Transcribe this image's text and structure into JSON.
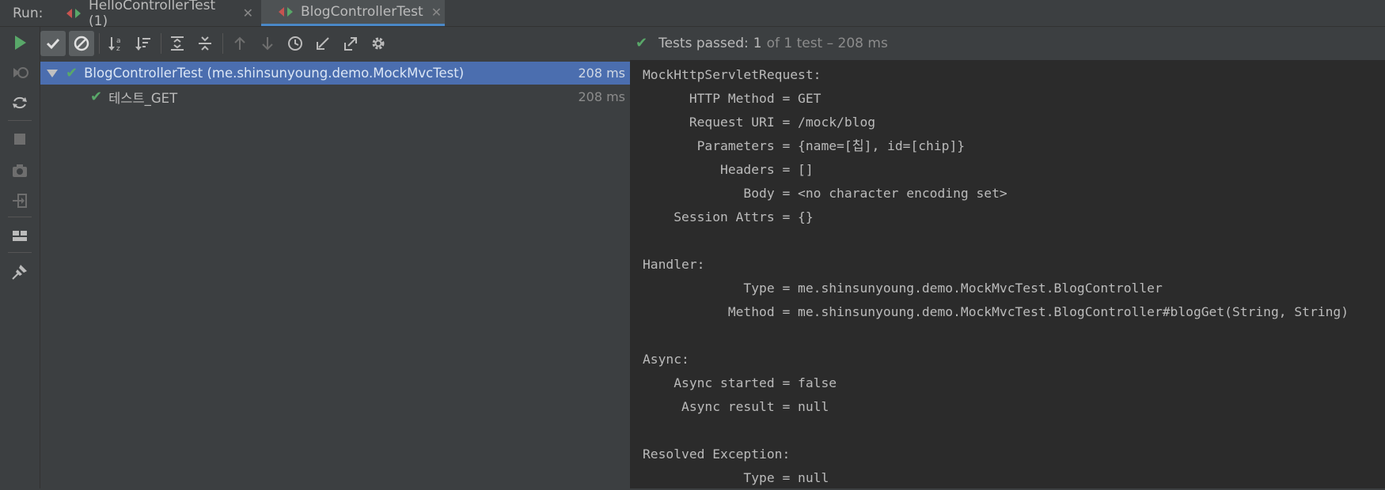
{
  "run_label": "Run:",
  "tabs": [
    {
      "label": "HelloControllerTest (1)",
      "close": "✕",
      "icon": "test-class-icon"
    },
    {
      "label": "BlogControllerTest",
      "close": "✕",
      "icon": "test-class-icon"
    }
  ],
  "status": {
    "passed": "Tests passed:",
    "count": "1",
    "rest": "of 1 test – 208 ms"
  },
  "tree": {
    "root": {
      "label": "BlogControllerTest (me.shinsunyoung.demo.MockMvcTest)",
      "time": "208 ms"
    },
    "child": {
      "label": "테스트_GET",
      "time": "208 ms"
    }
  },
  "console": {
    "lines": [
      "MockHttpServletRequest:",
      "      HTTP Method = GET",
      "      Request URI = /mock/blog",
      "       Parameters = {name=[칩], id=[chip]}",
      "          Headers = []",
      "             Body = <no character encoding set>",
      "    Session Attrs = {}",
      "",
      "Handler:",
      "             Type = me.shinsunyoung.demo.MockMvcTest.BlogController",
      "           Method = me.shinsunyoung.demo.MockMvcTest.BlogController#blogGet(String, String)",
      "",
      "Async:",
      "    Async started = false",
      "     Async result = null",
      "",
      "Resolved Exception:",
      "             Type = null"
    ]
  },
  "colors": {
    "accent": "#4a88c7",
    "success": "#59a869",
    "selected_row": "#4b6eaf"
  }
}
